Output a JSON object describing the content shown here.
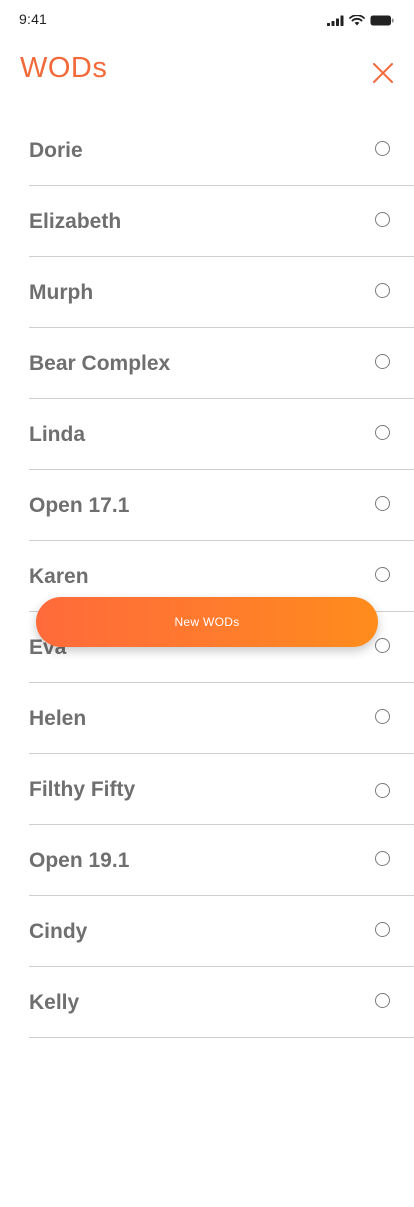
{
  "status_bar": {
    "time": "9:41",
    "icons": [
      "signal-icon",
      "wifi-icon",
      "battery-icon"
    ]
  },
  "header": {
    "title": "WODs",
    "close_icon": "close-icon",
    "accent_color": "#f26a3a"
  },
  "wods": [
    {
      "label": "Dorie",
      "selected": false
    },
    {
      "label": "Elizabeth",
      "selected": false
    },
    {
      "label": "Murph",
      "selected": false
    },
    {
      "label": "Bear Complex",
      "selected": false
    },
    {
      "label": "Linda",
      "selected": false
    },
    {
      "label": "Open 17.1",
      "selected": false
    },
    {
      "label": "Karen",
      "selected": false
    },
    {
      "label": "Eva",
      "selected": false
    },
    {
      "label": "Helen",
      "selected": false
    },
    {
      "label": "Filthy Fifty",
      "selected": false
    },
    {
      "label": "Open 19.1",
      "selected": false
    },
    {
      "label": "Cindy",
      "selected": false
    },
    {
      "label": "Kelly",
      "selected": false
    }
  ],
  "fab": {
    "label": "New WODs",
    "gradient_start": "#ff6a3a",
    "gradient_end": "#ff8c1c"
  }
}
